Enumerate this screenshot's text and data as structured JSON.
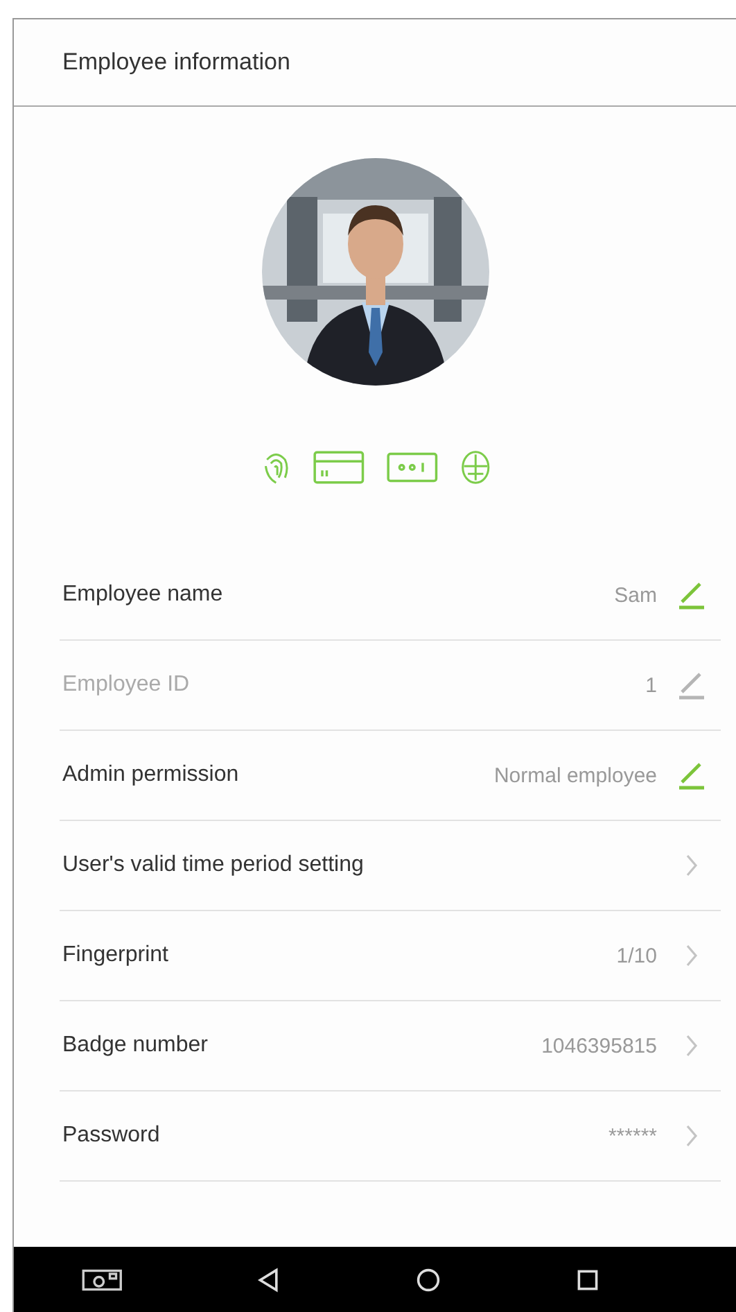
{
  "header": {
    "title": "Employee information"
  },
  "rows": [
    {
      "kind": "edit",
      "label": "Employee name",
      "value": "Sam",
      "disabled": false
    },
    {
      "kind": "edit",
      "label": "Employee ID",
      "value": "1",
      "disabled": true
    },
    {
      "kind": "edit",
      "label": "Admin permission",
      "value": "Normal employee",
      "disabled": false
    },
    {
      "kind": "link",
      "label": "User's valid time period setting"
    },
    {
      "kind": "link",
      "label": "Fingerprint",
      "value": "1/10"
    },
    {
      "kind": "link",
      "label": "Badge number",
      "value": "1046395815"
    },
    {
      "kind": "link",
      "label": "Password",
      "value": "******"
    }
  ]
}
